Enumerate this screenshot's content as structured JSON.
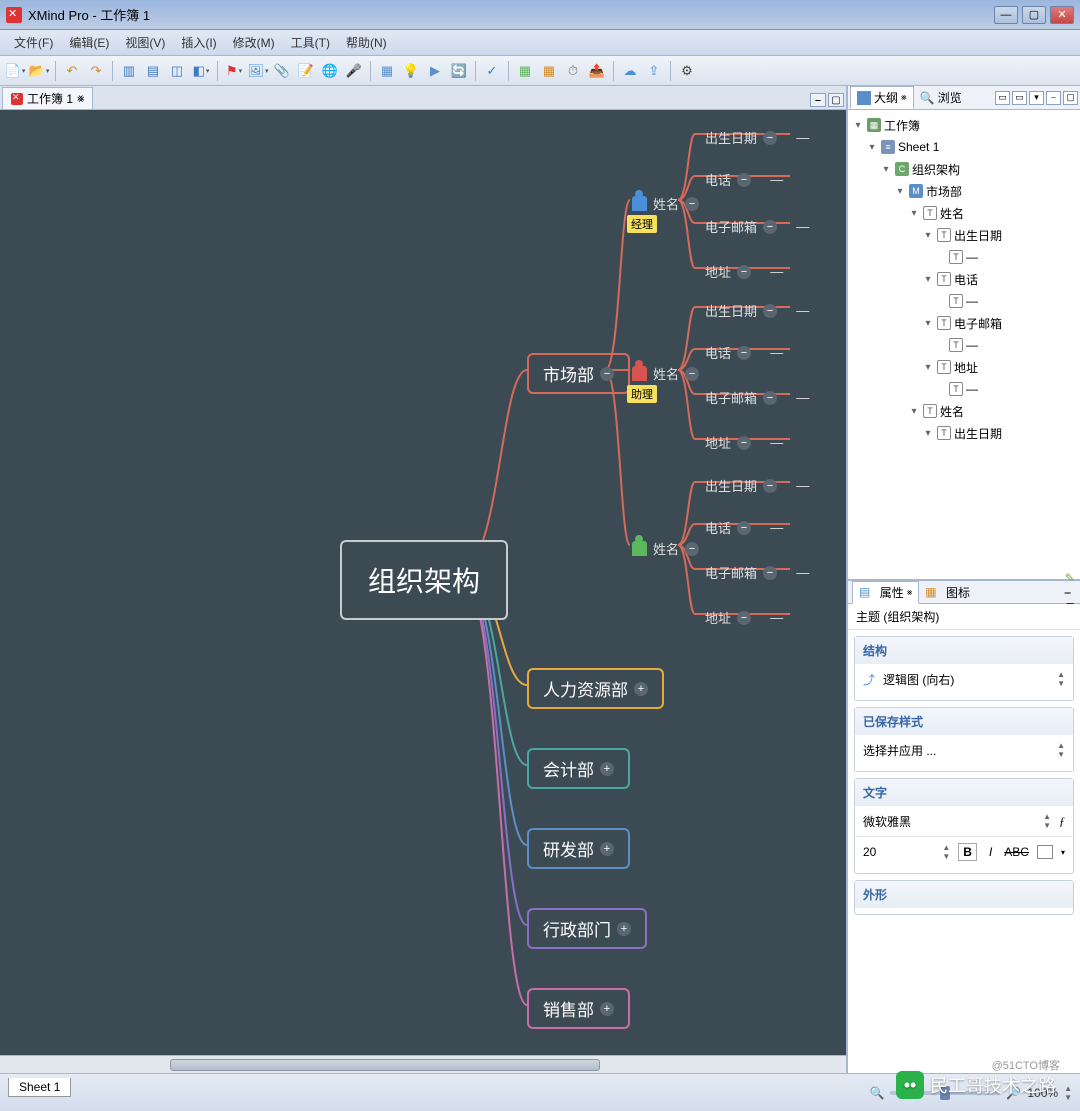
{
  "titlebar": {
    "app": "XMind Pro",
    "doc": "工作簿 1"
  },
  "menu": [
    "文件(F)",
    "编辑(E)",
    "视图(V)",
    "插入(I)",
    "修改(M)",
    "工具(T)",
    "帮助(N)"
  ],
  "tabs": {
    "editor": "工作簿 1",
    "marker": "⨳"
  },
  "right": {
    "tab_outline": "大纲",
    "tab_browse": "浏览",
    "tab_props": "属性",
    "tab_icons": "图标",
    "outline": {
      "wb": "工作簿",
      "sheet": "Sheet 1",
      "root": "组织架构",
      "market": "市场部",
      "name": "姓名",
      "dob": "出生日期",
      "phone": "电话",
      "email": "电子邮箱",
      "addr": "地址",
      "dash": "—"
    },
    "props": {
      "topic_label": "主题",
      "topic_val": "(组织架构)",
      "sec_struct": "结构",
      "struct_val": "逻辑图 (向右)",
      "sec_style": "已保存样式",
      "style_val": "选择并应用 ...",
      "sec_text": "文字",
      "font": "微软雅黑",
      "size": "20",
      "sec_shape": "外形"
    }
  },
  "canvas": {
    "root": "组织架构",
    "branches": {
      "market": "市场部",
      "hr": "人力资源部",
      "acct": "会计部",
      "rd": "研发部",
      "admin": "行政部门",
      "sales": "销售部"
    },
    "person": "姓名",
    "tags": {
      "mgr": "经理",
      "asst": "助理"
    },
    "fields": {
      "dob": "出生日期",
      "phone": "电话",
      "email": "电子邮箱",
      "addr": "地址"
    },
    "dash": "—"
  },
  "footer": {
    "sheet": "Sheet 1",
    "zoom": "100%"
  },
  "watermark": "民工哥技术之路",
  "attribution": "@51CTO博客"
}
